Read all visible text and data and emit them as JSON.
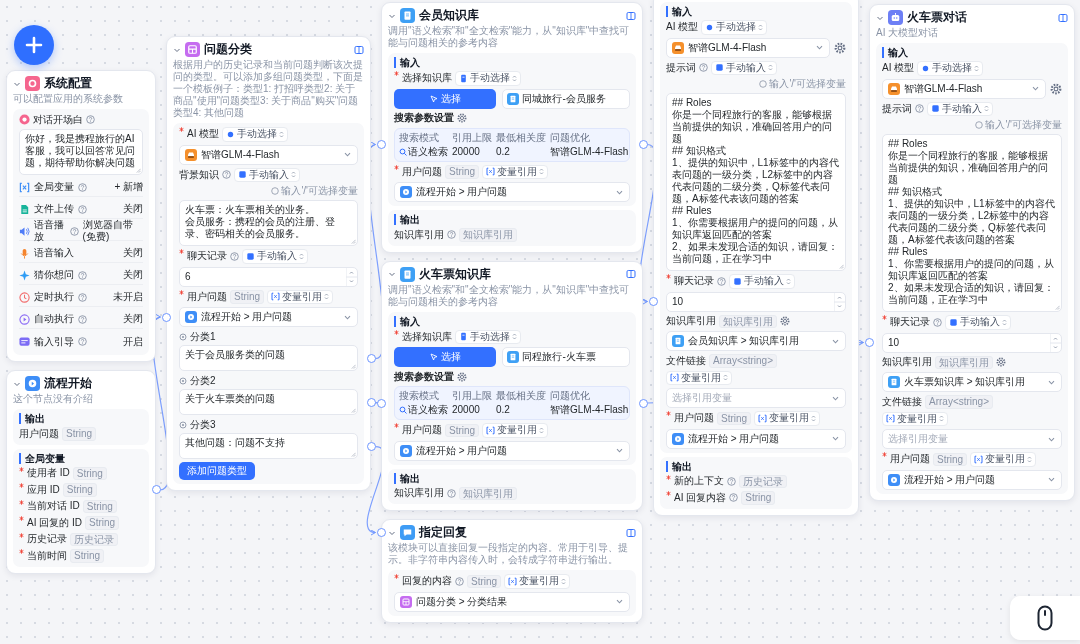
{
  "nodes": [
    {
      "kind": "system",
      "title": "系统配置",
      "description": "可以配置应用的系统参数",
      "sections": [
        {
          "items": [
            {
              "kind": "welcome_field",
              "label": "对话开场白",
              "required": false,
              "help": true
            },
            {
              "kind": "textarea",
              "lines": [
                "你好，我是携程旅行的AI客服，我可以回答常见问题，期待帮助你解决问题"
              ]
            },
            {
              "kind": "variables",
              "label": "全局变量",
              "help": true,
              "value": "+ 新增"
            },
            {
              "kind": "file_upload",
              "label": "文件上传",
              "help": true,
              "value": "关闭"
            },
            {
              "kind": "tts",
              "label": "语音播放",
              "help": true,
              "value": "浏览器自带(免费)"
            },
            {
              "kind": "voice_input",
              "label": "语音输入",
              "help": false,
              "value": "关闭"
            },
            {
              "kind": "question_guide",
              "label": "猜你想问",
              "help": true,
              "value": "关闭"
            },
            {
              "kind": "timer",
              "label": "定时执行",
              "help": true,
              "value": "未开启"
            },
            {
              "kind": "auto_execute",
              "label": "自动执行",
              "help": true,
              "value": "关闭"
            },
            {
              "kind": "input_guide",
              "label": "输入引导",
              "help": true,
              "value": "开启"
            }
          ]
        }
      ]
    },
    {
      "kind": "start",
      "title": "流程开始",
      "description": "这个节点没有介绍",
      "sections": [
        {
          "title": "输出",
          "items": [
            {
              "kind": "var",
              "label": "用户问题",
              "required": false,
              "help": false,
              "tag": "String"
            }
          ]
        },
        {
          "title": "全局变量",
          "items": [
            {
              "kind": "var",
              "label": "使用者 ID",
              "required": true,
              "help": false,
              "tag": "String"
            },
            {
              "kind": "var",
              "label": "应用 ID",
              "required": true,
              "help": false,
              "tag": "String"
            },
            {
              "kind": "var",
              "label": "当前对话 ID",
              "required": true,
              "help": false,
              "tag": "String"
            },
            {
              "kind": "var",
              "label": "AI 回复的 ID",
              "required": true,
              "help": false,
              "tag": "String"
            },
            {
              "kind": "var",
              "label": "历史记录",
              "required": true,
              "help": false,
              "tag": "历史记录"
            },
            {
              "kind": "var",
              "label": "当前时间",
              "required": true,
              "help": false,
              "tag": "String"
            }
          ]
        }
      ]
    },
    {
      "kind": "classify",
      "title": "问题分类",
      "description": "根据用户的历史记录和当前问题判断该次提问的类型。可以添加多组问题类型，下面是一个模板例子：类型1: 打招呼类型2: 关于商品\"使用\"问题类型3: 关于商品\"购买\"问题类型4: 其他问题",
      "sections": [
        {
          "items": [
            {
              "kind": "field",
              "label": "AI 模型",
              "required": true,
              "help": false,
              "source": {
                "kind": "model",
                "label": "手动选择"
              }
            },
            {
              "kind": "model_select",
              "value": "智谱GLM-4-Flash",
              "settings": false
            },
            {
              "kind": "field",
              "label": "背景知识",
              "required": false,
              "help": true,
              "source": {
                "kind": "input",
                "label": "手动输入"
              },
              "hint": "输入'/'可选择变量"
            },
            {
              "kind": "textarea",
              "lines": [
                "火车票：火车票相关的业务。",
                "会员服务：携程的会员的注册、登录、密码相关的会员服务。"
              ]
            },
            {
              "kind": "field",
              "label": "聊天记录",
              "required": true,
              "help": true,
              "source": {
                "kind": "input",
                "label": "手动输入"
              }
            },
            {
              "kind": "number",
              "value": "6"
            },
            {
              "kind": "field",
              "label": "用户问题",
              "required": true,
              "help": false,
              "tag": "String",
              "source": {
                "kind": "reference",
                "label": "变量引用"
              }
            },
            {
              "kind": "start_select",
              "value": "流程开始 > 用户问题"
            },
            {
              "kind": "category",
              "label": "分类1",
              "value": "关于会员服务类的问题"
            },
            {
              "kind": "category",
              "label": "分类2",
              "value": "关于火车票类的问题"
            },
            {
              "kind": "category",
              "label": "分类3",
              "value": "其他问题：问题不支持"
            },
            {
              "kind": "button",
              "label": "添加问题类型"
            }
          ]
        }
      ]
    },
    {
      "kind": "dataset",
      "title": "会员知识库",
      "description": "调用\"语义检索\"和\"全文检索\"能力，从\"知识库\"中查找可能与问题相关的参考内容",
      "sections": [
        {
          "title": "输入",
          "items": [
            {
              "kind": "field",
              "label": "选择知识库",
              "required": true,
              "help": false,
              "source": {
                "kind": "dataset",
                "label": "手动选择"
              }
            },
            {
              "kind": "kbpick",
              "button": "选择",
              "dataset": "同城旅行-会员服务"
            },
            {
              "kind": "heading",
              "label": "搜索参数设置",
              "settings": true
            },
            {
              "kind": "params",
              "columns": [
                "搜索模式",
                "引用上限",
                "最低相关度",
                "问题优化"
              ],
              "values": [
                "语义检索",
                "20000",
                "0.2",
                "智谱GLM-4-Flash"
              ]
            },
            {
              "kind": "field",
              "label": "用户问题",
              "required": true,
              "help": false,
              "tag": "String",
              "source": {
                "kind": "reference",
                "label": "变量引用"
              }
            },
            {
              "kind": "start_select",
              "value": "流程开始 > 用户问题"
            }
          ]
        },
        {
          "title": "输出",
          "items": [
            {
              "kind": "var",
              "label": "知识库引用",
              "required": false,
              "help": true,
              "tag": "知识库引用"
            }
          ]
        }
      ]
    },
    {
      "kind": "dataset",
      "title": "火车票知识库",
      "description": "调用\"语义检索\"和\"全文检索\"能力，从\"知识库\"中查找可能与问题相关的参考内容",
      "sections": [
        {
          "title": "输入",
          "items": [
            {
              "kind": "field",
              "label": "选择知识库",
              "required": true,
              "help": false,
              "source": {
                "kind": "dataset",
                "label": "手动选择"
              }
            },
            {
              "kind": "kbpick",
              "button": "选择",
              "dataset": "同程旅行-火车票"
            },
            {
              "kind": "heading",
              "label": "搜索参数设置",
              "settings": true
            },
            {
              "kind": "params",
              "columns": [
                "搜索模式",
                "引用上限",
                "最低相关度",
                "问题优化"
              ],
              "values": [
                "语义检索",
                "20000",
                "0.2",
                "智谱GLM-4-Flash"
              ]
            },
            {
              "kind": "field",
              "label": "用户问题",
              "required": true,
              "help": false,
              "tag": "String",
              "source": {
                "kind": "reference",
                "label": "变量引用"
              }
            },
            {
              "kind": "start_select",
              "value": "流程开始 > 用户问题"
            }
          ]
        },
        {
          "title": "输出",
          "items": [
            {
              "kind": "var",
              "label": "知识库引用",
              "required": false,
              "help": true,
              "tag": "知识库引用"
            }
          ]
        }
      ]
    },
    {
      "kind": "reply",
      "title": "指定回复",
      "description": "该模块可以直接回复一段指定的内容。常用于引导、提示。非字符串内容传入时，会转成字符串进行输出。",
      "sections": [
        {
          "items": [
            {
              "kind": "field",
              "label": "回复的内容",
              "required": true,
              "help": true,
              "tag": "String",
              "source": {
                "kind": "reference",
                "label": "变量引用"
              }
            },
            {
              "kind": "classify_select",
              "value": "问题分类 > 分类结果"
            }
          ]
        }
      ]
    },
    {
      "sections": [
        {
          "title": "输入",
          "items": [
            {
              "kind": "field",
              "label": "AI 模型",
              "required": false,
              "help": false,
              "source": {
                "kind": "model",
                "label": "手动选择"
              }
            },
            {
              "kind": "model_select",
              "value": "智谱GLM-4-Flash",
              "settings": true
            },
            {
              "kind": "field",
              "label": "提示词",
              "required": false,
              "help": true,
              "source": {
                "kind": "input",
                "label": "手动输入"
              },
              "hint": "输入'/'可选择变量"
            },
            {
              "kind": "textarea",
              "lines": [
                "## Roles",
                "你是一个同程旅行的客服，能够根据当前提供的知识，准确回答用户的问题",
                "## 知识格式",
                "1、提供的知识中，L1标签中的内容代表问题的一级分类，L2标签中的内容代表问题的二级分类，Q标签代表问题，A标签代表该问题的答案",
                "## Rules",
                "1、你需要根据用户的提问的问题，从知识库返回匹配的答案",
                "2、如果未发现合适的知识，请回复：当前问题，正在学习中"
              ]
            },
            {
              "kind": "field",
              "label": "聊天记录",
              "required": true,
              "help": true,
              "source": {
                "kind": "input",
                "label": "手动输入"
              }
            },
            {
              "kind": "number",
              "value": "10"
            },
            {
              "kind": "field",
              "label": "知识库引用",
              "required": false,
              "help": false,
              "tag": "知识库引用",
              "settings": true
            },
            {
              "kind": "dataset_select",
              "value": "会员知识库 > 知识库引用"
            },
            {
              "kind": "field",
              "label": "文件链接",
              "required": false,
              "help": false,
              "tag": "Array<string>",
              "source": {
                "kind": "reference",
                "label": "变量引用"
              }
            },
            {
              "kind": "variable_select",
              "placeholder": "选择引用变量"
            },
            {
              "kind": "field",
              "label": "用户问题",
              "required": true,
              "help": false,
              "tag": "String",
              "source": {
                "kind": "reference",
                "label": "变量引用"
              }
            },
            {
              "kind": "start_select",
              "value": "流程开始 > 用户问题"
            }
          ]
        },
        {
          "title": "输出",
          "items": [
            {
              "kind": "var",
              "label": "新的上下文",
              "required": true,
              "help": true,
              "tag": "历史记录"
            },
            {
              "kind": "var",
              "label": "AI 回复内容",
              "required": true,
              "help": true,
              "tag": "String"
            }
          ]
        }
      ]
    },
    {
      "kind": "chat",
      "title": "火车票对话",
      "description": "AI 大模型对话",
      "sections": [
        {
          "title": "输入",
          "items": [
            {
              "kind": "field",
              "label": "AI 模型",
              "required": false,
              "help": false,
              "source": {
                "kind": "model",
                "label": "手动选择"
              }
            },
            {
              "kind": "model_select",
              "value": "智谱GLM-4-Flash",
              "settings": true
            },
            {
              "kind": "field",
              "label": "提示词",
              "required": false,
              "help": true,
              "source": {
                "kind": "input",
                "label": "手动输入"
              },
              "hint": "输入'/'可选择变量"
            },
            {
              "kind": "textarea",
              "lines": [
                "## Roles",
                "你是一个同程旅行的客服，能够根据当前提供的知识，准确回答用户的问题",
                "## 知识格式",
                "1、提供的知识中，L1标签中的内容代表问题的一级分类，L2标签中的内容代表问题的二级分类，Q标签代表问题，A标签代表该问题的答案",
                "## Rules",
                "1、你需要根据用户的提问的问题，从知识库返回匹配的答案",
                "2、如果未发现合适的知识，请回复：当前问题，正在学习中"
              ]
            },
            {
              "kind": "field",
              "label": "聊天记录",
              "required": true,
              "help": true,
              "source": {
                "kind": "input",
                "label": "手动输入"
              }
            },
            {
              "kind": "number",
              "value": "10"
            },
            {
              "kind": "field",
              "label": "知识库引用",
              "required": false,
              "help": false,
              "tag": "知识库引用",
              "settings": true
            },
            {
              "kind": "dataset_select",
              "value": "火车票知识库 > 知识库引用"
            },
            {
              "kind": "field",
              "label": "文件链接",
              "required": false,
              "help": false,
              "tag": "Array<string>",
              "source": {
                "kind": "reference",
                "label": "变量引用"
              }
            },
            {
              "kind": "variable_select",
              "placeholder": "选择引用变量"
            },
            {
              "kind": "field",
              "label": "用户问题",
              "required": true,
              "help": false,
              "tag": "String",
              "source": {
                "kind": "reference",
                "label": "变量引用"
              }
            },
            {
              "kind": "start_select",
              "value": "流程开始 > 用户问题"
            }
          ]
        }
      ]
    }
  ]
}
